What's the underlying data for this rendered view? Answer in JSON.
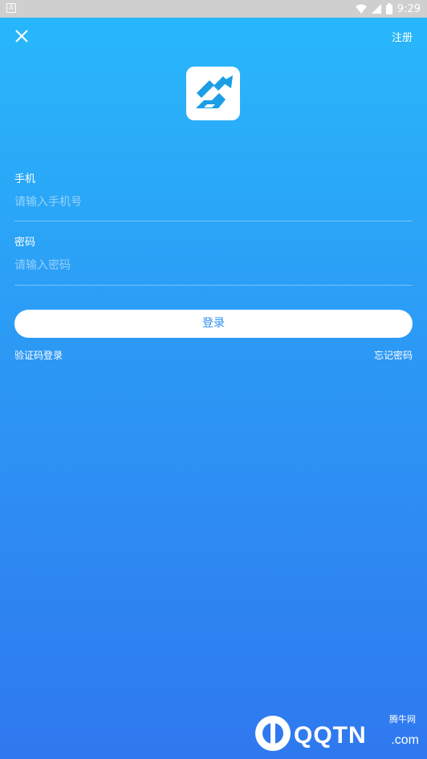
{
  "status_bar": {
    "time": "9:29",
    "left_icon": "A"
  },
  "header": {
    "register_label": "注册"
  },
  "form": {
    "phone": {
      "label": "手机",
      "placeholder": "请输入手机号",
      "value": ""
    },
    "password": {
      "label": "密码",
      "placeholder": "请输入密码",
      "value": ""
    }
  },
  "actions": {
    "login_label": "登录",
    "sms_login_label": "验证码登录",
    "forgot_password_label": "忘记密码"
  },
  "watermark": {
    "brand": "QQTN",
    "domain": ".com",
    "sub": "腾牛网"
  },
  "colors": {
    "gradient_top": "#28b9fb",
    "gradient_bottom": "#2f78ef",
    "button_text": "#2e8df2"
  }
}
